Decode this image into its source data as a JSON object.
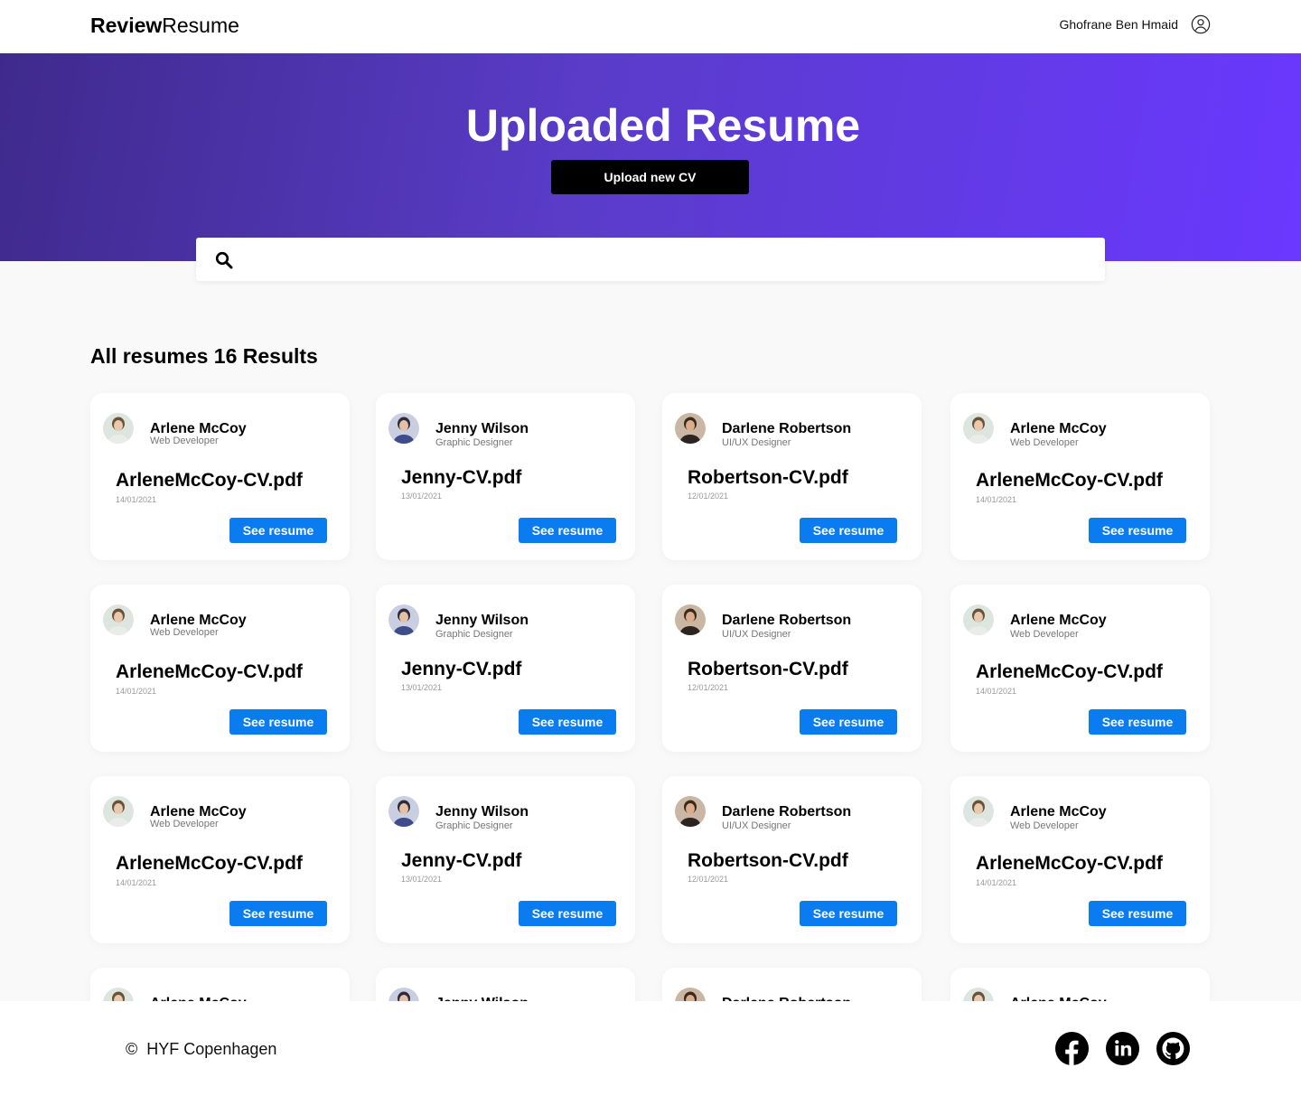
{
  "header": {
    "logo_bold": "Review",
    "logo_regular": "Resume",
    "user_name": "Ghofrane Ben Hmaid",
    "user_icon": "user-circle-icon"
  },
  "hero": {
    "title": "Uploaded Resume",
    "upload_label": "Upload new CV",
    "colors": {
      "gradient_start": "#3f2a8c",
      "gradient_end": "#6a38ff"
    }
  },
  "search": {
    "icon": "search-icon",
    "value": "",
    "placeholder": ""
  },
  "results": {
    "title": "All resumes 16 Results"
  },
  "resumes": [
    {
      "name": "Arlene McCoy",
      "role": "Web Developer",
      "file": "ArleneMcCoy-CV.pdf",
      "date": "14/01/2021",
      "button": "See resume"
    },
    {
      "name": "Jenny Wilson",
      "role": "Graphic Designer",
      "file": "Jenny-CV.pdf",
      "date": "13/01/2021",
      "button": "See resume"
    },
    {
      "name": "Darlene Robertson",
      "role": "UI/UX Designer",
      "file": "Robertson-CV.pdf",
      "date": "12/01/2021",
      "button": "See resume"
    },
    {
      "name": "Arlene McCoy",
      "role": "Web Developer",
      "file": "ArleneMcCoy-CV.pdf",
      "date": "14/01/2021",
      "button": "See resume"
    },
    {
      "name": "Arlene McCoy",
      "role": "Web Developer",
      "file": "ArleneMcCoy-CV.pdf",
      "date": "14/01/2021",
      "button": "See resume"
    },
    {
      "name": "Jenny Wilson",
      "role": "Graphic Designer",
      "file": "Jenny-CV.pdf",
      "date": "13/01/2021",
      "button": "See resume"
    },
    {
      "name": "Darlene Robertson",
      "role": "UI/UX Designer",
      "file": "Robertson-CV.pdf",
      "date": "12/01/2021",
      "button": "See resume"
    },
    {
      "name": "Arlene McCoy",
      "role": "Web Developer",
      "file": "ArleneMcCoy-CV.pdf",
      "date": "14/01/2021",
      "button": "See resume"
    },
    {
      "name": "Arlene McCoy",
      "role": "Web Developer",
      "file": "ArleneMcCoy-CV.pdf",
      "date": "14/01/2021",
      "button": "See resume"
    },
    {
      "name": "Jenny Wilson",
      "role": "Graphic Designer",
      "file": "Jenny-CV.pdf",
      "date": "13/01/2021",
      "button": "See resume"
    },
    {
      "name": "Darlene Robertson",
      "role": "UI/UX Designer",
      "file": "Robertson-CV.pdf",
      "date": "12/01/2021",
      "button": "See resume"
    },
    {
      "name": "Arlene McCoy",
      "role": "Web Developer",
      "file": "ArleneMcCoy-CV.pdf",
      "date": "14/01/2021",
      "button": "See resume"
    },
    {
      "name": "Arlene McCoy"
    },
    {
      "name": "Jenny Wilson"
    },
    {
      "name": "Darlene Robertson"
    },
    {
      "name": "Arlene McCoy"
    }
  ],
  "footer": {
    "copyright_symbol": "©",
    "copyright_text": "HYF Copenhagen",
    "social_icons": [
      "facebook-icon",
      "linkedin-icon",
      "github-icon"
    ]
  },
  "colors": {
    "accent_button": "#0a7cf0",
    "dark_button": "#000000",
    "page_background": "#f9f9f9"
  }
}
